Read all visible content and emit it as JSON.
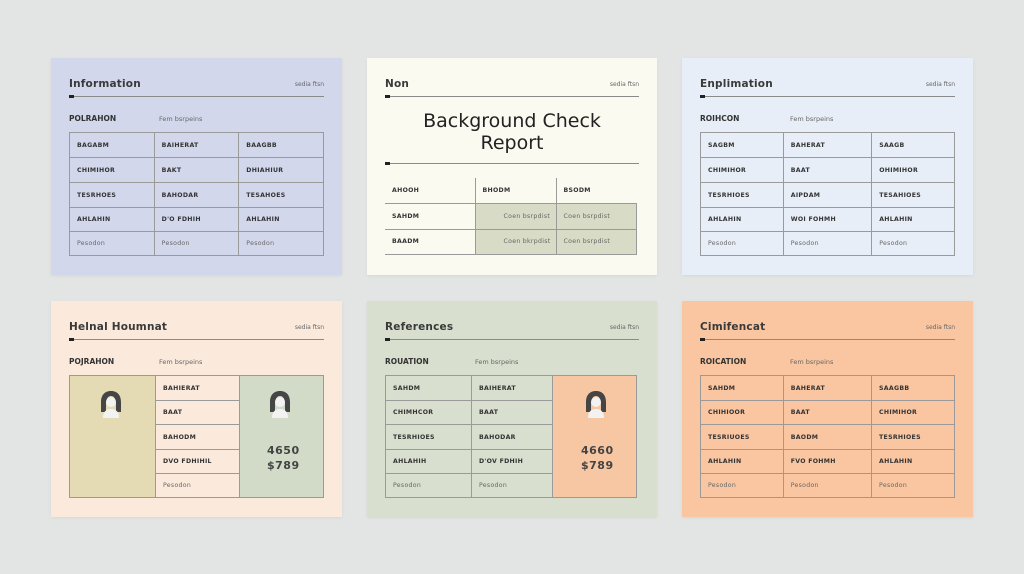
{
  "cards": [
    {
      "title": "Information",
      "meta": "sedia ftsn",
      "subtitle": "POLRAHON",
      "note": "Fem bsrpeins",
      "rows": [
        [
          "BAGABM",
          "BAIHERAT",
          "BAAGBB"
        ],
        [
          "CHIMIHOR",
          "BAKT",
          "DHIAHIUR"
        ],
        [
          "TESRHOES",
          "BAHODAR",
          "TESAHOES"
        ],
        [
          "AHLAHIN",
          "D'O FDHIH",
          "AHLAHIN"
        ],
        [
          "Pesodon",
          "Pesodon",
          "Pesodon"
        ]
      ]
    },
    {
      "title": "Non",
      "meta": "sedia ftsn",
      "heading_line1": "Background Check",
      "heading_line2": "Report",
      "header_row": [
        "AHOOH",
        "BHODM",
        "BSODM"
      ],
      "rows": [
        [
          "SAHDM",
          "Coen bsrpdist",
          "Coen bsrpdist"
        ],
        [
          "BAADM",
          "Coen bkrpdist",
          "Coen bsrpdist"
        ]
      ]
    },
    {
      "title": "Enplimation",
      "meta": "sedia ftsn",
      "subtitle": "ROIHCON",
      "note": "Fem bsrpeins",
      "rows": [
        [
          "SAGBM",
          "BAHERAT",
          "SAAGB"
        ],
        [
          "CHIMIHOR",
          "BAAT",
          "OHIMIHOR"
        ],
        [
          "TESRHIOES",
          "AIPDAM",
          "TESAHIOES"
        ],
        [
          "AHLAHIN",
          "WOI FOHMH",
          "AHLAHIN"
        ],
        [
          "Pesodon",
          "Pesodon",
          "Pesodon"
        ]
      ]
    },
    {
      "title": "Helnal Houmnat",
      "meta": "sedia ftsn",
      "subtitle": "POJRAHON",
      "note": "Fem bsrpeins",
      "rows": [
        "BAHIERAT",
        "BAAT",
        "BAHODM",
        "DVO FDHIHIL",
        "Pesodon"
      ],
      "price_line1": "4650",
      "price_line2": "$789"
    },
    {
      "title": "References",
      "meta": "sedia ftsn",
      "subtitle": "ROUATION",
      "note": "Fem bsrpeins",
      "rows": [
        [
          "SAHDM",
          "BAIHERAT"
        ],
        [
          "CHIMHCOR",
          "BAAT"
        ],
        [
          "TESRHIOES",
          "BAHODAR"
        ],
        [
          "AHLAHIH",
          "D'OV FDHIH"
        ],
        [
          "Pesodon",
          "Pesodon"
        ]
      ],
      "price_line1": "4660",
      "price_line2": "$789"
    },
    {
      "title": "Cimifencat",
      "meta": "sedia ftsn",
      "subtitle": "ROICATION",
      "note": "Fem bsrpeins",
      "rows": [
        [
          "SAHDM",
          "BAHERAT",
          "SAAGBB"
        ],
        [
          "CHIHIOOR",
          "BAAT",
          "CHIMIHOR"
        ],
        [
          "TESRIUOES",
          "BAODM",
          "TESRHIOES"
        ],
        [
          "AHLAHIN",
          "FVO FOHMH",
          "AHLAHIN"
        ],
        [
          "Pesodon",
          "Pesodon",
          "Pesodon"
        ]
      ]
    }
  ],
  "colors": {
    "background": "#e3e5e5",
    "card1": "#d3d7ec",
    "card2": "#fafaf1",
    "card3": "#e8eef7",
    "card4": "#fbe9dc",
    "card5": "#d8dfce",
    "card6": "#f9c6a1",
    "accent_olive": "#d8dbc6",
    "accent_tan": "#e4dbb5",
    "accent_sage": "#d2dbc8",
    "accent_peach": "#f7c6a2",
    "avatar": "#454545"
  }
}
